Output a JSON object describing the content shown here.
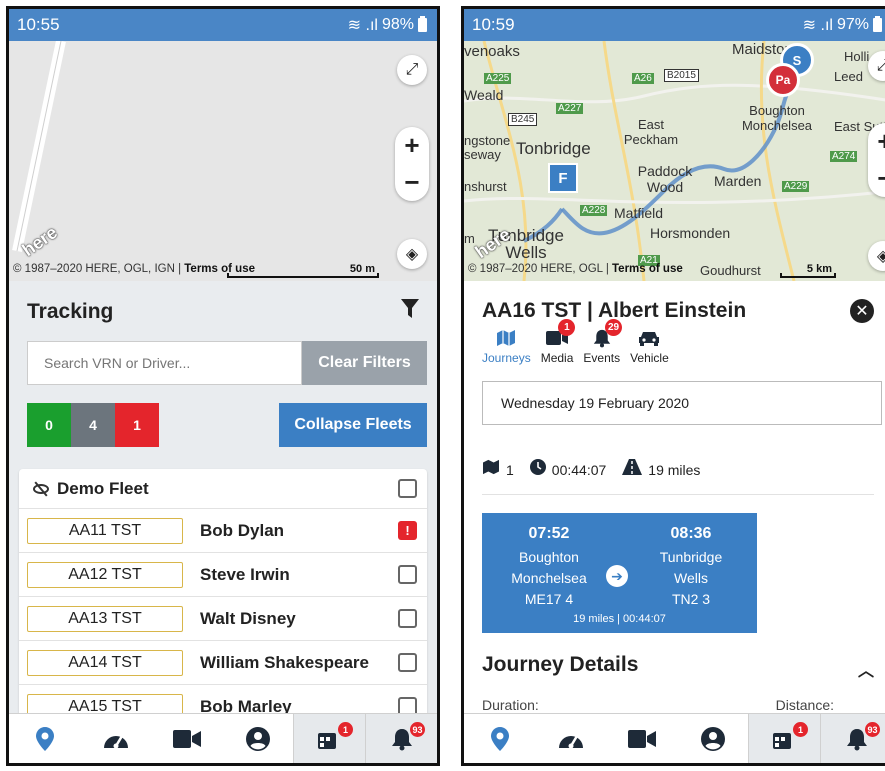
{
  "left": {
    "status": {
      "time": "10:55",
      "battery": "98%"
    },
    "map": {
      "copyright": "© 1987–2020 HERE, OGL, IGN | ",
      "terms": "Terms of use",
      "scale": "50 m",
      "logo": "here"
    },
    "tracking": {
      "title": "Tracking",
      "search_placeholder": "Search VRN or Driver...",
      "clear_filters": "Clear Filters",
      "counts": [
        {
          "value": "0",
          "color": "#1a9f2e"
        },
        {
          "value": "4",
          "color": "#6c757d"
        },
        {
          "value": "1",
          "color": "#e4252c"
        }
      ],
      "collapse_fleets": "Collapse Fleets"
    },
    "fleet": {
      "name": "Demo Fleet",
      "vehicles": [
        {
          "vrn": "AA11 TST",
          "driver": "Bob Dylan",
          "alert": "!"
        },
        {
          "vrn": "AA12 TST",
          "driver": "Steve Irwin"
        },
        {
          "vrn": "AA13 TST",
          "driver": "Walt Disney"
        },
        {
          "vrn": "AA14 TST",
          "driver": "William Shakespeare"
        },
        {
          "vrn": "AA15 TST",
          "driver": "Bob Marley"
        }
      ]
    }
  },
  "right": {
    "status": {
      "time": "10:59",
      "battery": "97%"
    },
    "map": {
      "copyright": "© 1987–2020 HERE, OGL | ",
      "terms": "Terms of use",
      "scale": "5 km",
      "logo": "here",
      "places": {
        "sevenoaks": "venoaks",
        "maidstone": "Maidstone",
        "weald": "Weald",
        "tonbridge": "Tonbridge",
        "east_peckham": "East Peckham",
        "paddock_wood": "Paddock Wood",
        "marden": "Marden",
        "matfield": "Matfield",
        "horsmonden": "Horsmonden",
        "tunbridge_wells": "Tunbridge Wells",
        "boughton": "Boughton Monchelsea",
        "hildenborough": "ngstone",
        "seway": "seway",
        "nshurst": "nshurst",
        "goudhurst": "Goudhurst",
        "east_sutton": "East Sutt",
        "holli": "Holli",
        "leed": "Leed",
        "m": "m"
      },
      "roads": [
        "A225",
        "A26",
        "B2015",
        "B245",
        "A227",
        "A274",
        "A229",
        "A228",
        "A21"
      ],
      "markers": {
        "start": "F",
        "parked": "Pa",
        "stop": "S"
      }
    },
    "vehicle_title": "AA16 TST | Albert Einstein",
    "tabs": [
      {
        "label": "Journeys",
        "badge": null
      },
      {
        "label": "Media",
        "badge": "1"
      },
      {
        "label": "Events",
        "badge": "29"
      },
      {
        "label": "Vehicle",
        "badge": null
      }
    ],
    "date": "Wednesday 19 February 2020",
    "summary": {
      "journeys": "1",
      "duration": "00:44:07",
      "distance": "19 miles"
    },
    "journey": {
      "start_time": "07:52",
      "start_place": [
        "Boughton",
        "Monchelsea",
        "ME17 4"
      ],
      "end_time": "08:36",
      "end_place": [
        "Tunbridge",
        "Wells",
        "TN2 3"
      ],
      "footer": "19 miles | 00:44:07"
    },
    "details_title": "Journey Details",
    "details_labels": {
      "duration": "Duration:",
      "distance": "Distance:"
    }
  },
  "navbar": {
    "items": [
      "map-marker-icon",
      "dashboard-gauge-icon",
      "video-camera-icon",
      "user-circle-icon",
      "events-calendar-icon",
      "bell-icon"
    ],
    "badges": {
      "events": "1",
      "bell": "93"
    }
  },
  "colors": {
    "primary": "#3b7fc4",
    "status_bar": "#4a86c6",
    "alert": "#e4252c",
    "ok": "#1a9f2e",
    "neutral": "#6c757d",
    "route": "#5f8fc9",
    "marker_parked": "#d32f3a"
  }
}
